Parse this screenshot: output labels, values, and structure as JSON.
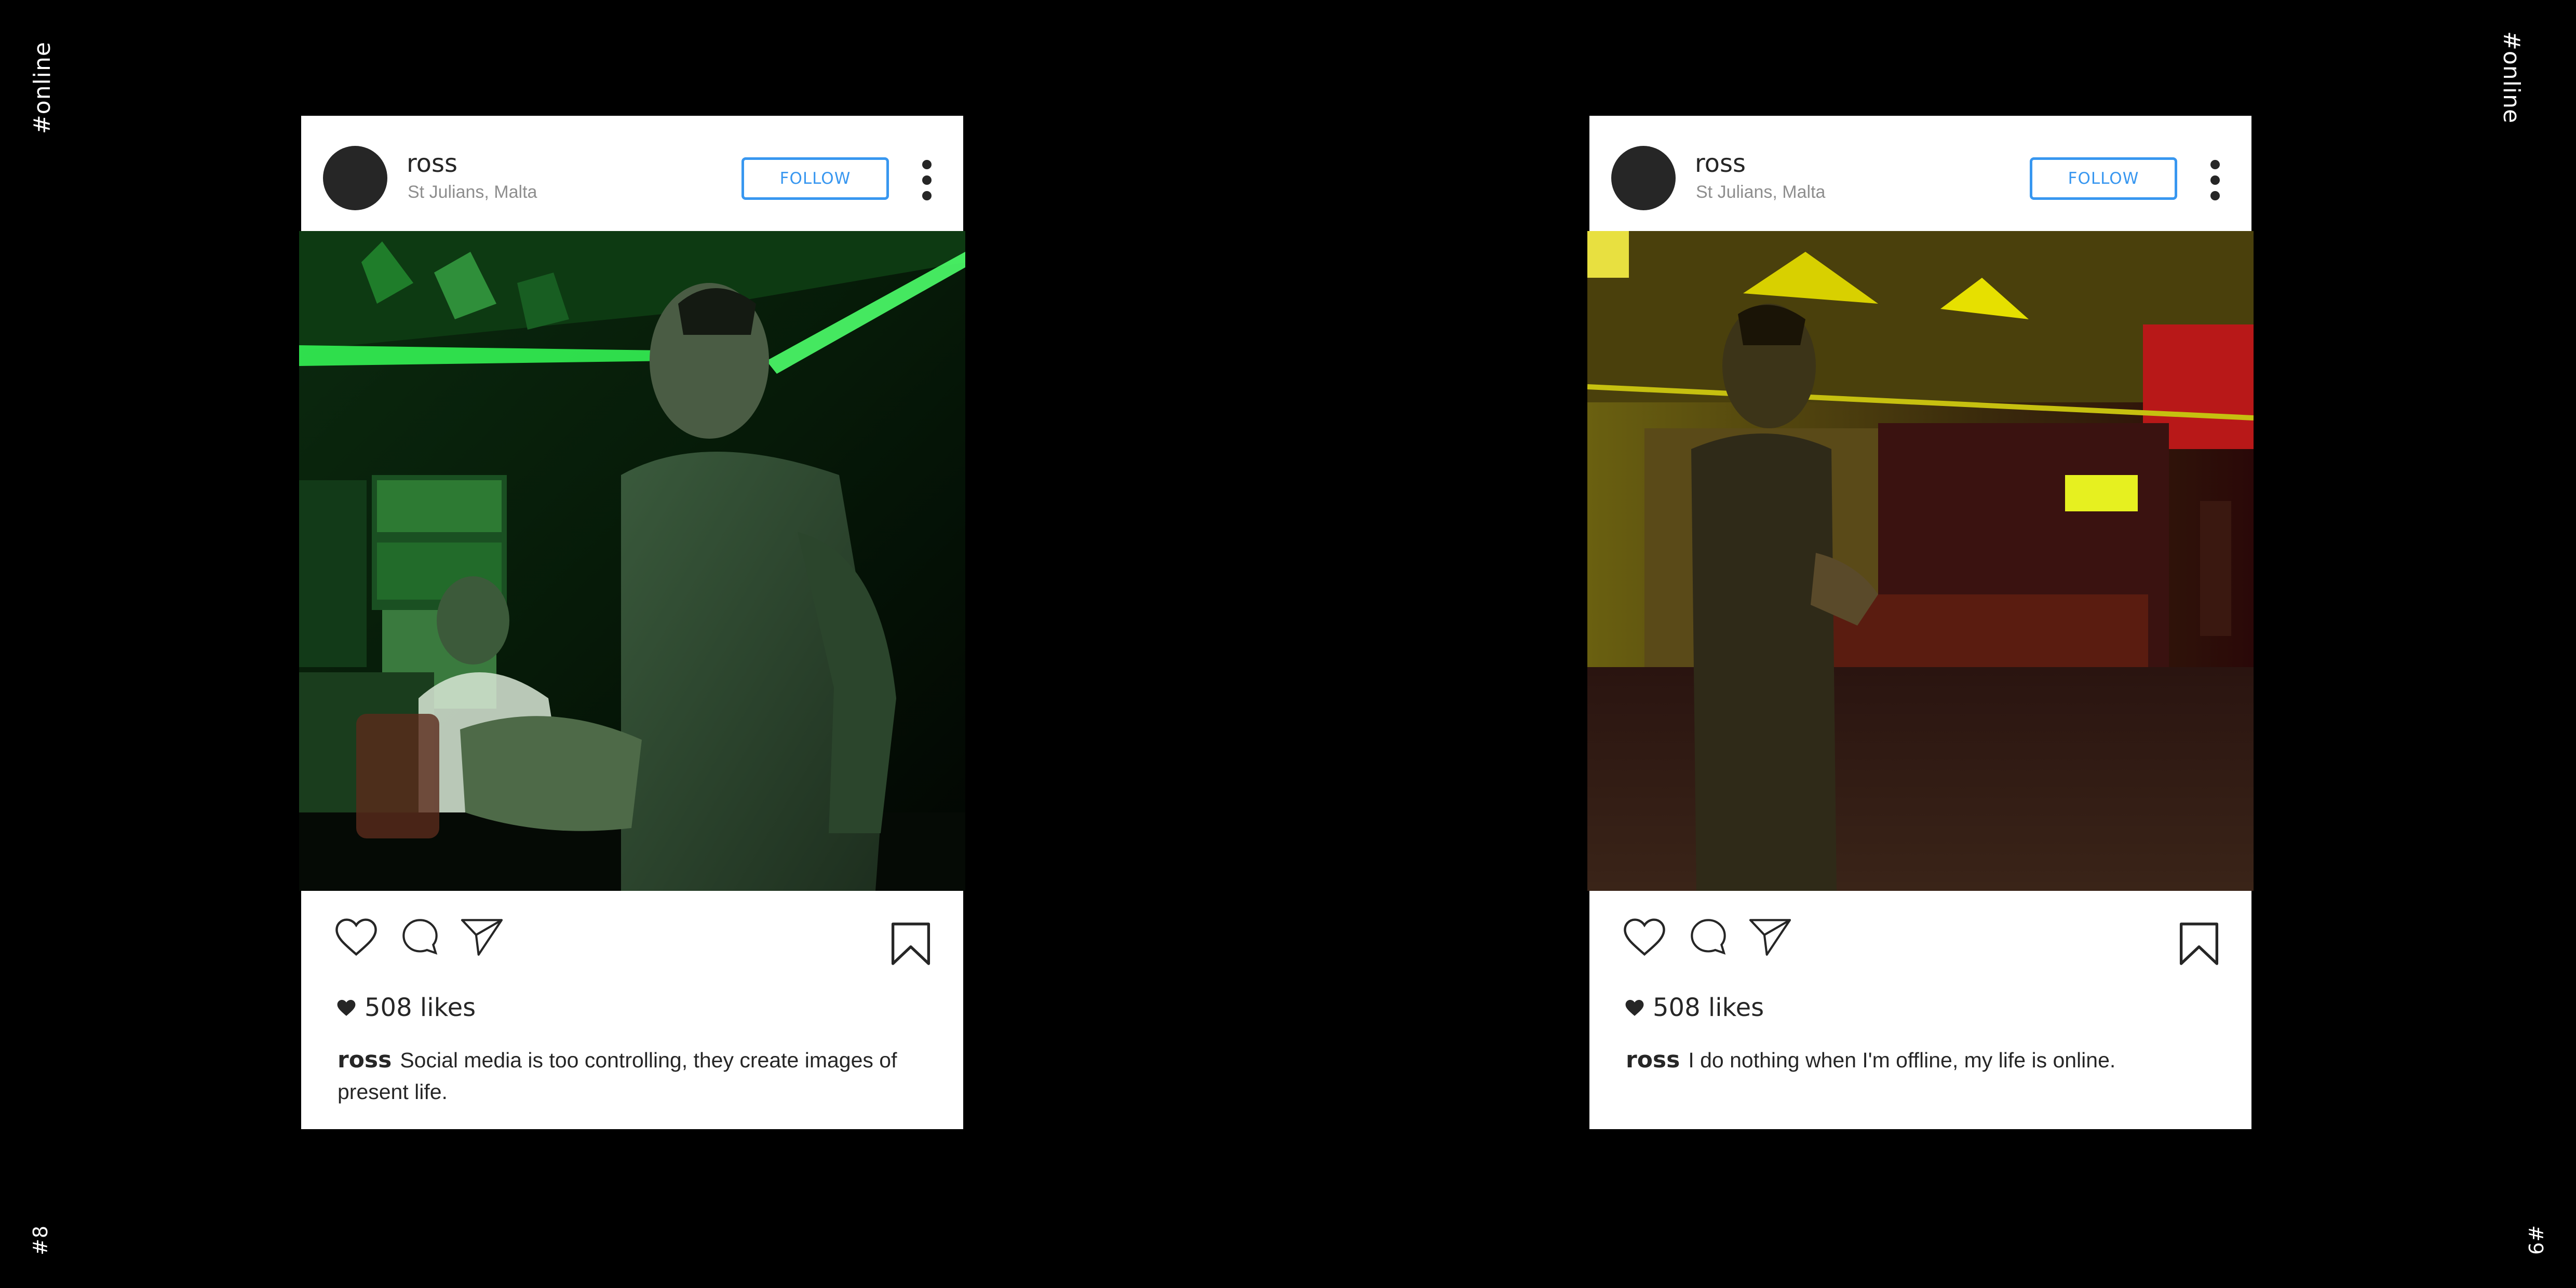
{
  "side_labels": {
    "left_top": "#online",
    "right_top": "#online",
    "left_bottom": "#8",
    "right_bottom": "#9"
  },
  "colors": {
    "background": "#000000",
    "card": "#ffffff",
    "follow_accent": "#3897f0",
    "avatar": "#262626"
  },
  "posts": [
    {
      "username": "ross",
      "location": "St Julians, Malta",
      "follow_label": "FOLLOW",
      "likes": "508 likes",
      "caption_user": "ross",
      "caption_text": "Social media is too controlling, they create images of present life."
    },
    {
      "username": "ross",
      "location": "St Julians, Malta",
      "follow_label": "FOLLOW",
      "likes": "508 likes",
      "caption_user": "ross",
      "caption_text": "I do nothing when I'm offline, my life is online."
    }
  ],
  "icons": [
    "heart-icon",
    "comment-icon",
    "share-icon",
    "bookmark-icon",
    "more-options-icon"
  ]
}
